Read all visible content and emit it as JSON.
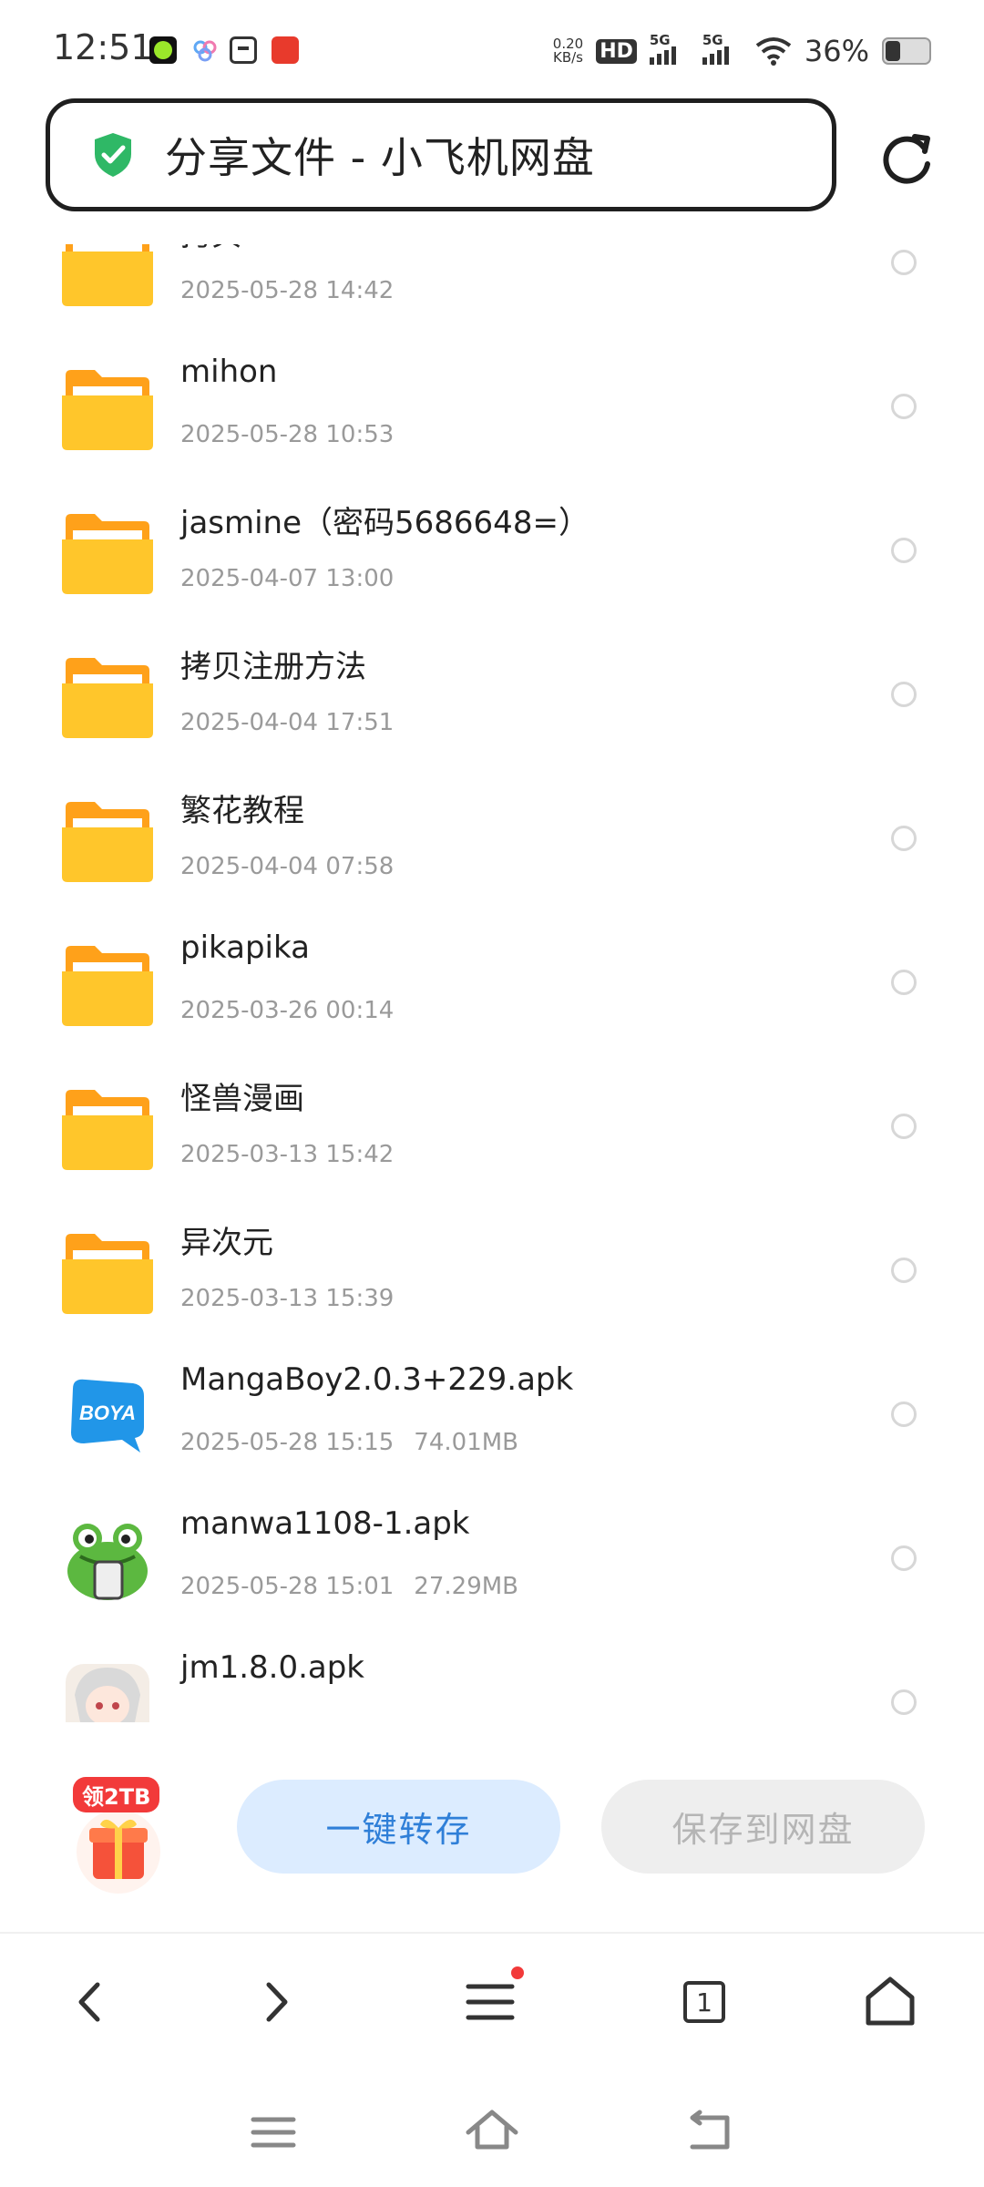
{
  "status_bar": {
    "time": "12:51",
    "net_speed_value": "0.20",
    "net_speed_unit": "KB/s",
    "hd_label": "HD",
    "signal_label": "5G",
    "battery_percent": "36%",
    "battery_level": 0.36
  },
  "address_bar": {
    "title": "分享文件 - 小飞机网盘",
    "shield_color": "#2fb866"
  },
  "files": [
    {
      "name": "拷贝",
      "meta": "2025-05-28 14:42",
      "size": "",
      "type": "folder"
    },
    {
      "name": "mihon",
      "meta": "2025-05-28 10:53",
      "size": "",
      "type": "folder"
    },
    {
      "name": "jasmine（密码5686648=）",
      "meta": "2025-04-07 13:00",
      "size": "",
      "type": "folder"
    },
    {
      "name": "拷贝注册方法",
      "meta": "2025-04-04 17:51",
      "size": "",
      "type": "folder"
    },
    {
      "name": "繁花教程",
      "meta": "2025-04-04 07:58",
      "size": "",
      "type": "folder"
    },
    {
      "name": "pikapika",
      "meta": "2025-03-26 00:14",
      "size": "",
      "type": "folder"
    },
    {
      "name": "怪兽漫画",
      "meta": "2025-03-13 15:42",
      "size": "",
      "type": "folder"
    },
    {
      "name": "异次元",
      "meta": "2025-03-13 15:39",
      "size": "",
      "type": "folder"
    },
    {
      "name": "MangaBoy2.0.3+229.apk",
      "meta": "2025-05-28 15:15",
      "size": "74.01MB",
      "type": "apk",
      "icon": "boya-app-icon"
    },
    {
      "name": "manwa1108-1.apk",
      "meta": "2025-05-28 15:01",
      "size": "27.29MB",
      "type": "apk",
      "icon": "frog-app-icon"
    },
    {
      "name": "jm1.8.0.apk",
      "meta": "",
      "size": "",
      "type": "apk",
      "icon": "anime-girl-app-icon"
    }
  ],
  "icons": {
    "boya_text": "BOYA"
  },
  "actions": {
    "gift_badge": "领2TB",
    "transfer_label": "一键转存",
    "save_label": "保存到网盘",
    "accent_color": "#2f7fd8"
  },
  "browser_nav": {
    "tabs_count": "1"
  }
}
